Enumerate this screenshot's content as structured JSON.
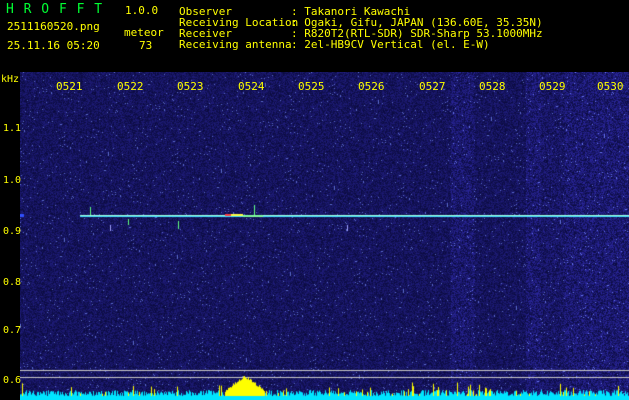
{
  "header": {
    "app_title": "H R O F F T",
    "version": "1.0.0",
    "filename": "2511160520.png",
    "datetime": "25.11.16 05:20",
    "mode_label": "meteor",
    "meteor_count": "73"
  },
  "station": {
    "observer_label": "Observer",
    "observer_value": ": Takanori Kawachi",
    "location_label": "Receiving Location",
    "location_value": ": Ogaki, Gifu, JAPAN (136.60E, 35.35N)",
    "receiver_label": "Receiver",
    "receiver_value": ": R820T2(RTL-SDR) SDR-Sharp 53.1000MHz",
    "antenna_label": "Receiving antenna",
    "antenna_value": ": 2el-HB9CV Vertical (el. E-W)"
  },
  "axis": {
    "unit": "kHz",
    "y_ticks": [
      "1.1",
      "1.0",
      "0.9",
      "0.8",
      "0.7",
      "0.6"
    ],
    "x_ticks": [
      "0521",
      "0522",
      "0523",
      "0524",
      "0525",
      "0526",
      "0527",
      "0528",
      "0529",
      "0530"
    ]
  },
  "colors": {
    "text_yellow": "#ffff00",
    "text_green": "#00ff33",
    "background_blue": "#0a0a5a",
    "trace_cyan": "#40e0ff",
    "power_yellow": "#ffff00",
    "power_cyan": "#00e5ff"
  },
  "chart_data": {
    "type": "heatmap",
    "xlabel": "",
    "ylabel": "kHz",
    "x_ticks": [
      "0521",
      "0522",
      "0523",
      "0524",
      "0525",
      "0526",
      "0527",
      "0528",
      "0529",
      "0530"
    ],
    "y_ticks": [
      1.1,
      1.0,
      0.9,
      0.8,
      0.7,
      0.6
    ],
    "ylim": [
      0.58,
      1.18
    ],
    "carrier_frequency_khz": 0.925,
    "carrier_start_minute": "0521",
    "meteor_echo_minute": "0524"
  }
}
